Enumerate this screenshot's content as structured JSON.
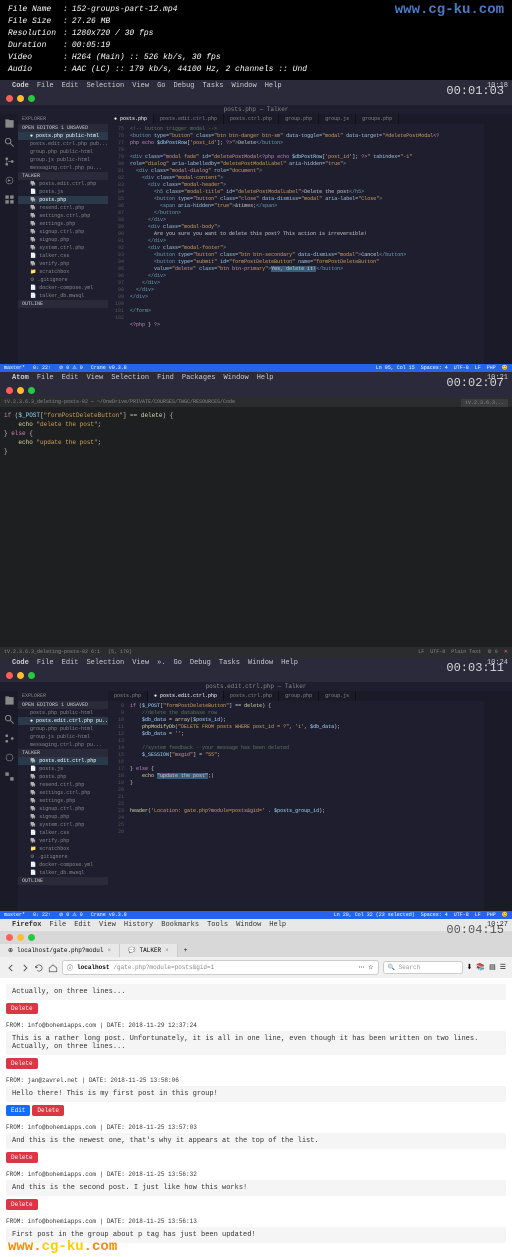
{
  "watermarks": {
    "top": "www.cg-ku.com",
    "bottom_left": "www.cg-ku.com"
  },
  "meta": {
    "filename_label": "File Name",
    "filename": "152-groups-part-12.mp4",
    "filesize_label": "File Size",
    "filesize": "27.26 MB",
    "resolution_label": "Resolution",
    "resolution": "1280x720 / 30 fps",
    "duration_label": "Duration",
    "duration": "00:05:19",
    "video_label": "Video",
    "video": "H264 (Main) :: 526 kb/s, 30 fps",
    "audio_label": "Audio",
    "audio": "AAC (LC) :: 179 kb/s, 44100 Hz, 2 channels :: Und"
  },
  "vs1": {
    "timestamp": "00:01:03",
    "clock": "10:18",
    "app_name": "Code",
    "menu": [
      "File",
      "Edit",
      "Selection",
      "View",
      "Go",
      "Debug",
      "Tasks",
      "Window",
      "Help"
    ],
    "title": "posts.php — Talker",
    "explorer": "EXPLORER",
    "open_editors_label": "OPEN EDITORS  1 UNSAVED",
    "project": "TALKER",
    "outline": "OUTLINE",
    "sidebar_items": [
      "posts.php public-html",
      "posts.edit.ctrl.php pub...",
      "group.php public-html",
      "group.js public-html",
      "messaging.ctrl.php pu..."
    ],
    "file_items": [
      "posts.edit.ctrl.php",
      "posts.js",
      "posts.php",
      "resend.ctrl.php",
      "settings.ctrl.php",
      "settings.php",
      "signup.ctrl.php",
      "signup.php",
      "system.ctrl.php",
      "talker.css",
      "verify.php",
      "scratchbox",
      ".gitignore",
      "docker-compose.yml",
      "talker_db.mwsql"
    ],
    "active_file": "posts.php",
    "tabs": [
      "posts.php",
      "posts.edit.ctrl.php",
      "posts.ctrl.php",
      "group.php",
      "group.js",
      "groups.php"
    ],
    "status_left": [
      "master*",
      "0↓ 22↑",
      "⊘ 0 ⚠ 0",
      "Crane v0.3.8"
    ],
    "status_right": [
      "Ln 95, Col 15",
      "Spaces: 4",
      "UTF-8",
      "LF",
      "PHP",
      "😊"
    ],
    "code_html": "<span class='c-com'>&lt;!-- button trigger modal --&gt;</span>\n<span class='c-tag'>&lt;button</span> <span class='c-attr'>type=</span><span class='c-str'>\"button\"</span> <span class='c-attr'>class=</span><span class='c-str'>\"btn btn-danger btn-sm\"</span> <span class='c-attr'>data-toggle=</span><span class='c-str'>\"modal\"</span> <span class='c-attr'>data-target=</span><span class='c-str'>\"#deletePostModal</span><span class='c-kw'>&lt;?</span>\n<span class='c-kw'>php echo</span> <span class='c-var'>$dbPostRow</span>[<span class='c-str'>'post_id'</span>]; <span class='c-kw'>?&gt;</span><span class='c-str'>\"</span><span class='c-tag'>&gt;</span>Delete<span class='c-tag'>&lt;/button&gt;</span>\n\n<span class='c-tag'>&lt;div</span> <span class='c-attr'>class=</span><span class='c-str'>\"modal fade\"</span> <span class='c-attr'>id=</span><span class='c-str'>\"deletePostModal</span><span class='c-kw'>&lt;?php echo</span> <span class='c-var'>$dbPostRow</span>[<span class='c-str'>'post_id'</span>]; <span class='c-kw'>?&gt;</span><span class='c-str'>\"</span> <span class='c-attr'>tabindex=</span><span class='c-str'>\"-1\"</span>\n<span class='c-attr'>role=</span><span class='c-str'>\"dialog\"</span> <span class='c-attr'>aria-labelledby=</span><span class='c-str'>\"deletePostModalLabel\"</span> <span class='c-attr'>aria-hidden=</span><span class='c-str'>\"true\"</span><span class='c-tag'>&gt;</span>\n  <span class='c-tag'>&lt;div</span> <span class='c-attr'>class=</span><span class='c-str'>\"modal-dialog\"</span> <span class='c-attr'>role=</span><span class='c-str'>\"document\"</span><span class='c-tag'>&gt;</span>\n    <span class='c-tag'>&lt;div</span> <span class='c-attr'>class=</span><span class='c-str'>\"modal-content\"</span><span class='c-tag'>&gt;</span>\n      <span class='c-tag'>&lt;div</span> <span class='c-attr'>class=</span><span class='c-str'>\"modal-header\"</span><span class='c-tag'>&gt;</span>\n        <span class='c-tag'>&lt;h5</span> <span class='c-attr'>class=</span><span class='c-str'>\"modal-title\"</span> <span class='c-attr'>id=</span><span class='c-str'>\"deletePostModalLabel\"</span><span class='c-tag'>&gt;</span>Delete the post<span class='c-tag'>&lt;/h5&gt;</span>\n        <span class='c-tag'>&lt;button</span> <span class='c-attr'>type=</span><span class='c-str'>\"button\"</span> <span class='c-attr'>class=</span><span class='c-str'>\"close\"</span> <span class='c-attr'>data-dismiss=</span><span class='c-str'>\"modal\"</span> <span class='c-attr'>aria-label=</span><span class='c-str'>\"Close\"</span><span class='c-tag'>&gt;</span>\n          <span class='c-tag'>&lt;span</span> <span class='c-attr'>aria-hidden=</span><span class='c-str'>\"true\"</span><span class='c-tag'>&gt;</span>&amp;times;<span class='c-tag'>&lt;/span&gt;</span>\n        <span class='c-tag'>&lt;/button&gt;</span>\n      <span class='c-tag'>&lt;/div&gt;</span>\n      <span class='c-tag'>&lt;div</span> <span class='c-attr'>class=</span><span class='c-str'>\"modal-body\"</span><span class='c-tag'>&gt;</span>\n        Are you sure you want to delete this post? This action is irreversible!\n      <span class='c-tag'>&lt;/div&gt;</span>\n      <span class='c-tag'>&lt;div</span> <span class='c-attr'>class=</span><span class='c-str'>\"modal-footer\"</span><span class='c-tag'>&gt;</span>\n        <span class='c-tag'>&lt;button</span> <span class='c-attr'>type=</span><span class='c-str'>\"button\"</span> <span class='c-attr'>class=</span><span class='c-str'>\"btn btn-secondary\"</span> <span class='c-attr'>data-dismiss=</span><span class='c-str'>\"modal\"</span><span class='c-tag'>&gt;</span>Cancel<span class='c-tag'>&lt;/button&gt;</span>\n        <span class='c-tag'>&lt;button</span> <span class='c-attr'>type=</span><span class='c-str'>\"submit\"</span> <span class='c-attr'>id=</span><span class='c-str'>\"formPostDeleteButton\"</span> <span class='c-attr'>name=</span><span class='c-str'>\"formPostDeleteButton\"</span>\n        <span class='c-attr'>value=</span><span class='c-str'>\"delete\"</span> <span class='c-attr'>class=</span><span class='c-str'>\"btn btn-primary\"</span><span class='c-tag'>&gt;</span><span class='c-sel'>Yes, delete it!</span><span class='c-tag'>&lt;/button&gt;</span>\n      <span class='c-tag'>&lt;/div&gt;</span>\n    <span class='c-tag'>&lt;/div&gt;</span>\n  <span class='c-tag'>&lt;/div&gt;</span>\n<span class='c-tag'>&lt;/div&gt;</span>\n\n<span class='c-tag'>&lt;/form&gt;</span>\n\n<span class='c-kw'>&lt;?php</span> } <span class='c-kw'>?&gt;</span>"
  },
  "atom": {
    "timestamp": "00:02:07",
    "clock": "10:21",
    "app_name": "Atom",
    "menu": [
      "File",
      "Edit",
      "View",
      "Selection",
      "Find",
      "Packages",
      "Window",
      "Help"
    ],
    "title": "tV.2.3.6.3_deleting-posts-02 — ~/OneDrive/PRIVATE/COURSES/TWGC/RESOURCES/Code",
    "tab_label": "tV.2.3.6.3...",
    "code_html": "<span class='c-kw'>if</span> (<span class='c-var'>$_POST</span>[<span class='c-str'>\"formPostDeleteButton\"</span>] == <span class='c-fn'>delete</span>) {\n    <span class='c-fn'>echo</span> <span class='c-str'>\"delete the post\"</span>;\n} <span class='c-kw'>else</span> {\n    <span class='c-fn'>echo</span> <span class='c-str'>\"update the post\"</span>;\n}\n",
    "status_left": [
      "tV.2.3.6.3_deleting-posts-02  6:1",
      "(5, 170)"
    ],
    "status_right": [
      "LF",
      "UTF-8",
      "Plain Text",
      "⚙ 0"
    ]
  },
  "vs2": {
    "timestamp": "00:03:11",
    "clock": "10:24",
    "title": "posts.edit.ctrl.php — Talker",
    "active_file": "posts.edit.ctrl.php",
    "tabs": [
      "posts.php",
      "posts.edit.ctrl.php",
      "posts.ctrl.php",
      "group.php",
      "group.js"
    ],
    "status_left": [
      "master*",
      "0↓ 22↑",
      "⊘ 0 ⚠ 0",
      "Crane v0.3.8"
    ],
    "status_right": [
      "Ln 20, Col 32 (23 selected)",
      "Spaces: 4",
      "UTF-8",
      "LF",
      "PHP",
      "😊"
    ],
    "code_html": "<span class='c-kw'>if</span> (<span class='c-var'>$_POST</span>[<span class='c-str'>\"formPostDeleteButton\"</span>] == <span class='c-fn'>delete</span>) {\n    <span class='c-com'>//delete the database row</span>\n    <span class='c-var'>$db_data</span> = <span class='c-fn'>array</span>(<span class='c-var'>$posts_id</span>);\n    <span class='c-fn'>phpModifyDb</span>(<span class='c-str'>\"DELETE FROM posts WHERE post_id = ?\"</span>, <span class='c-str'>'i'</span>, <span class='c-var'>$db_data</span>);\n    <span class='c-var'>$db_data</span> = <span class='c-str'>''</span>;\n\n    <span class='c-com'>//system feedback - your message has been deleted</span>\n    <span class='c-var'>$_SESSION</span>[<span class='c-str'>\"msgid\"</span>] = <span class='c-str'>\"55\"</span>;\n\n} <span class='c-kw'>else</span> {\n    <span class='c-fn'>echo</span> <span class='c-sel'>\"update the post\"</span>;|\n}\n\n\n\n<span class='c-fn'>header</span>(<span class='c-str'>'Location: gate.php?module=posts&gid='</span> . <span class='c-var'>$posts_group_id</span>);"
  },
  "firefox": {
    "timestamp": "00:04:15",
    "clock": "10:27",
    "app_name": "Firefox",
    "menu": [
      "File",
      "Edit",
      "View",
      "History",
      "Bookmarks",
      "Tools",
      "Window",
      "Help"
    ],
    "ff_tabs": [
      "localhost/gate.php?modul",
      "TALKER"
    ],
    "url_host": "localhost",
    "url_path": "/gate.php?module=posts&gid=1",
    "search_placeholder": "Search",
    "posts": [
      {
        "meta": "",
        "body": "Actually, on three lines...",
        "buttons": [
          "Delete"
        ]
      },
      {
        "meta": "FROM: info@bohemiapps.com | DATE: 2018-11-29 12:37:24",
        "body": "This is a rather long post. Unfortunately, it is all in one line, even though it has been written on two lines. Actually, on three lines...",
        "buttons": [
          "Delete"
        ]
      },
      {
        "meta": "FROM: jan@zavrel.net | DATE: 2018-11-25 13:58:06",
        "body": "Hello there! This is my first post in this group!",
        "buttons": [
          "Edit",
          "Delete"
        ]
      },
      {
        "meta": "FROM: info@bohemiapps.com | DATE: 2018-11-25 13:57:03",
        "body": "And this is the newest one, that's why it appears at the top of the list.",
        "buttons": [
          "Delete"
        ]
      },
      {
        "meta": "FROM: info@bohemiapps.com | DATE: 2018-11-25 13:56:32",
        "body": "And this is the second post. I just like how this works!",
        "buttons": [
          "Delete"
        ]
      },
      {
        "meta": "FROM: info@bohemiapps.com | DATE: 2018-11-25 13:56:13",
        "body": "First post in the group about p tag has just been updated!",
        "buttons": []
      }
    ]
  }
}
